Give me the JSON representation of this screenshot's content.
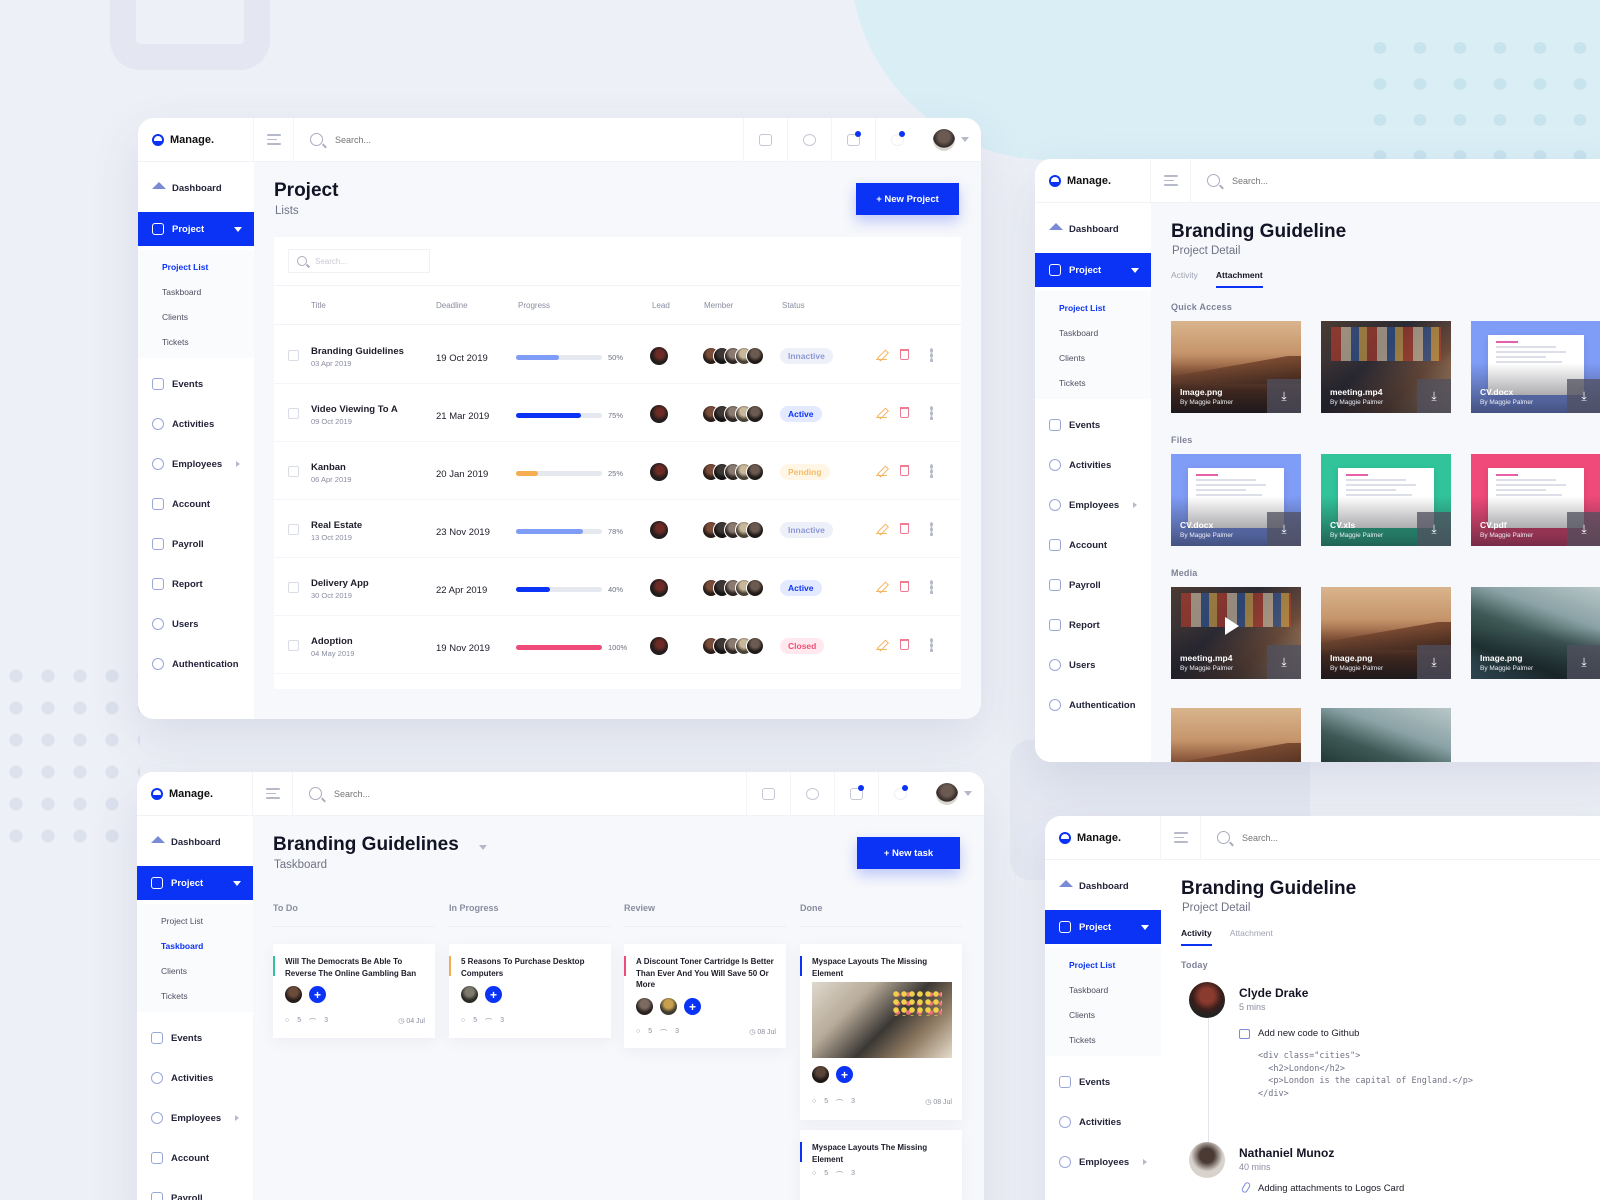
{
  "brand": "Manage.",
  "search_placeholder": "Search...",
  "nav": {
    "dashboard": "Dashboard",
    "project": "Project",
    "sub": [
      "Project List",
      "Taskboard",
      "Clients",
      "Tickets"
    ],
    "events": "Events",
    "activities": "Activities",
    "employees": "Employees",
    "account": "Account",
    "payroll": "Payroll",
    "report": "Report",
    "users": "Users",
    "authentication": "Authentication"
  },
  "project_list": {
    "title": "Project",
    "subtitle": "Lists",
    "new_button": "+ New Project",
    "search_placeholder": "Search...",
    "columns": [
      "Title",
      "Deadline",
      "Progress",
      "Lead",
      "Member",
      "Status"
    ],
    "rows": [
      {
        "title": "Branding Guidelines",
        "date": "03 Apr 2019",
        "deadline": "19 Oct 2019",
        "progress": 50,
        "progress_label": "50%",
        "color": "#7f9cf6",
        "status": "Innactive",
        "status_type": "inactive"
      },
      {
        "title": "Video Viewing To A",
        "date": "09 Oct 2019",
        "deadline": "21 Mar 2019",
        "progress": 75,
        "progress_label": "75%",
        "color": "#0a33f5",
        "status": "Active",
        "status_type": "active"
      },
      {
        "title": "Kanban",
        "date": "06 Apr 2019",
        "deadline": "20 Jan 2019",
        "progress": 25,
        "progress_label": "25%",
        "color": "#f5ad4f",
        "status": "Pending",
        "status_type": "pending"
      },
      {
        "title": "Real Estate",
        "date": "13 Oct 2019",
        "deadline": "23 Nov 2019",
        "progress": 78,
        "progress_label": "78%",
        "color": "#7f9cf6",
        "status": "Innactive",
        "status_type": "inactive"
      },
      {
        "title": "Delivery App",
        "date": "30 Oct 2019",
        "deadline": "22 Apr 2019",
        "progress": 40,
        "progress_label": "40%",
        "color": "#0a33f5",
        "status": "Active",
        "status_type": "active"
      },
      {
        "title": "Adoption",
        "date": "04 May 2019",
        "deadline": "19 Nov 2019",
        "progress": 100,
        "progress_label": "100%",
        "color": "#ef4a79",
        "status": "Closed",
        "status_type": "closed"
      }
    ]
  },
  "attachment": {
    "title": "Branding Guideline",
    "subtitle": "Project Detail",
    "tabs": [
      "Activity",
      "Attachment"
    ],
    "sections": [
      "Quick Access",
      "Files",
      "Media"
    ],
    "quick_access": [
      {
        "name": "Image.png",
        "by": "By Maggie Palmer",
        "kind": "desert"
      },
      {
        "name": "meeting.mp4",
        "by": "By Maggie Palmer",
        "kind": "meeting"
      },
      {
        "name": "CV.docx",
        "by": "By Maggie Palmer",
        "kind": "doc-blue"
      }
    ],
    "files": [
      {
        "name": "CV.docx",
        "by": "By Maggie Palmer",
        "kind": "doc-blue"
      },
      {
        "name": "CV.xls",
        "by": "By Maggie Palmer",
        "kind": "doc-green"
      },
      {
        "name": "CV.pdf",
        "by": "By Maggie Palmer",
        "kind": "doc-red"
      }
    ],
    "media": [
      {
        "name": "meeting.mp4",
        "by": "By Maggie Palmer",
        "kind": "meeting"
      },
      {
        "name": "Image.png",
        "by": "By Maggie Palmer",
        "kind": "desert"
      },
      {
        "name": "Image.png",
        "by": "By Maggie Palmer",
        "kind": "cliff"
      }
    ]
  },
  "taskboard": {
    "title": "Branding Guidelines",
    "subtitle": "Taskboard",
    "new_button": "+ New task",
    "columns": [
      "To Do",
      "In Progress",
      "Review",
      "Done"
    ],
    "cards": {
      "todo": {
        "text": "Will The Democrats Be Able To Reverse The Online Gambling Ban",
        "comments": "5",
        "attachments": "3",
        "date": "04 Jul"
      },
      "progress": {
        "text": "5 Reasons To Purchase Desktop Computers",
        "comments": "5",
        "attachments": "3"
      },
      "review": {
        "text": "A Discount Toner Cartridge Is Better Than Ever And You Will Save 50 Or More",
        "comments": "5",
        "attachments": "3",
        "date": "08 Jul"
      },
      "done1": {
        "text": "Myspace Layouts The Missing Element",
        "comments": "5",
        "attachments": "3",
        "date": "08 Jul"
      },
      "done2": {
        "text": "Myspace Layouts The Missing Element",
        "comments": "5",
        "attachments": "3"
      }
    }
  },
  "activity": {
    "title": "Branding Guideline",
    "subtitle": "Project Detail",
    "tabs": [
      "Activity",
      "Attachment"
    ],
    "today": "Today",
    "entries": [
      {
        "name": "Clyde Drake",
        "time": "5 mins",
        "action": "Add new code to Github"
      },
      {
        "name": "Nathaniel Munoz",
        "time": "40 mins",
        "action": "Adding attachments to Logos Card"
      }
    ],
    "code": "<div class=\"cities\">\n  <h2>London</h2>\n  <p>London is the capital of England.</p>\n</div>"
  },
  "colors": {
    "accent": "#0a33f5",
    "todo": "#31c39a",
    "progress": "#f5ad4f",
    "review": "#ef4a79",
    "done": "#0a33f5"
  }
}
